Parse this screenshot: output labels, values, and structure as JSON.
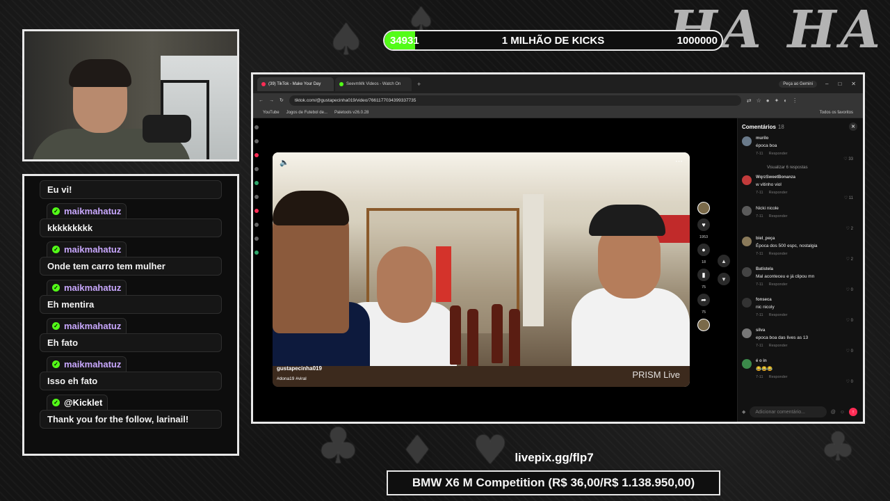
{
  "overlay": {
    "brand_text": "HA HA",
    "goal": {
      "current": "34931",
      "title": "1 MILHÃO DE KICKS",
      "target": "1000000",
      "progress_fraction": 0.035,
      "color": "#53fc18"
    },
    "donation": {
      "link": "livepix.gg/flp7",
      "prize": "BMW X6 M Competition (R$ 36,00/R$ 1.138.950,00)"
    }
  },
  "chat": {
    "messages": [
      {
        "user": "",
        "text": "Eu vi!"
      },
      {
        "user": "maikmahatuz",
        "text": "kkkkkkkkk"
      },
      {
        "user": "maikmahatuz",
        "text": "Onde tem carro tem mulher"
      },
      {
        "user": "maikmahatuz",
        "text": "Eh mentira"
      },
      {
        "user": "maikmahatuz",
        "text": "Eh fato"
      },
      {
        "user": "maikmahatuz",
        "text": "Isso eh fato"
      },
      {
        "user": "@Kicklet",
        "text": "Thank you for the follow, larinail!"
      }
    ]
  },
  "browser": {
    "tabs": [
      {
        "label": "(39) TikTok - Make Your Day",
        "active": true
      },
      {
        "label": "SeevmMk Videos - Watch On",
        "active": false
      }
    ],
    "new_tab": "+",
    "gemini_button": "Peça ao Gemini",
    "url": "tiktok.com/@gustapecinha019/video/7661177034399337735",
    "bookmarks": [
      "YouTube",
      "Jogos de Futebol de...",
      "Paletools v26.0.28"
    ],
    "all_bookmarks": "Todos os favoritos"
  },
  "video": {
    "author": "gustapecinha019",
    "tags": "#dona19 #viral",
    "watermark": "PRISM Live",
    "actions": [
      {
        "icon": "heart-icon",
        "count": "1953"
      },
      {
        "icon": "comment-icon",
        "count": "18"
      },
      {
        "icon": "bookmark-icon",
        "count": "75"
      },
      {
        "icon": "share-icon",
        "count": "75"
      }
    ]
  },
  "comments_panel": {
    "title": "Comentários",
    "count": "18",
    "reply_label": "Responder",
    "view_replies": "Visualizar 6 respostas",
    "input_placeholder": "Adicionar comentário...",
    "items": [
      {
        "name": "murilo",
        "text": "época boa",
        "date": "7-11",
        "likes": "33",
        "avatar": "#6a7a8a"
      },
      {
        "name": "WqrzSweetBonanza",
        "text": "w vitinho viol",
        "date": "7-11",
        "likes": "11",
        "avatar": "#c23b3b"
      },
      {
        "name": "",
        "text": "Nicki nicole",
        "date": "7-11",
        "likes": "2",
        "avatar": "#5a5a5a"
      },
      {
        "name": "biel_peça",
        "text": "Época dos 500 espc, nostalgia",
        "date": "7-11",
        "likes": "2",
        "avatar": "#8a7a5a"
      },
      {
        "name": "Batistela",
        "text": "Mal aconteceu e já clipou mn",
        "date": "7-11",
        "likes": "0",
        "avatar": "#444444"
      },
      {
        "name": "fonseca",
        "text": "nic nicoly",
        "date": "7-11",
        "likes": "0",
        "avatar": "#333333"
      },
      {
        "name": "silva",
        "text": "epoca boa das lives as 13",
        "date": "7-11",
        "likes": "0",
        "avatar": "#777777"
      },
      {
        "name": "é o in",
        "text": "😂😂😂",
        "date": "7-11",
        "likes": "0",
        "avatar": "#3b8a4a"
      }
    ]
  }
}
